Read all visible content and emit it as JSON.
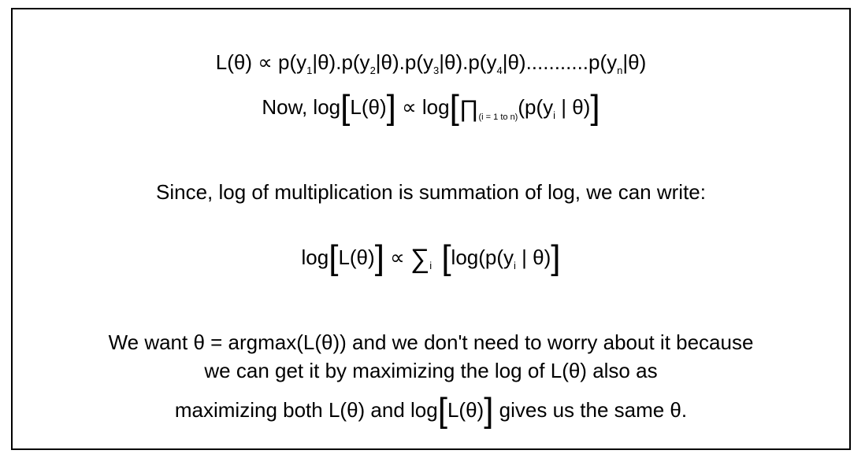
{
  "line1": {
    "prefix": "L(θ) ∝ p(y",
    "s1": "1",
    "t1": "|θ).p(y",
    "s2": "2",
    "t2": "|θ).p(y",
    "s3": "3",
    "t3": "|θ).p(y",
    "s4": "4",
    "t4": "|θ)...........p(y",
    "sn": "n",
    "t5": "|θ)"
  },
  "line2": {
    "now": "Now, log",
    "lb1": "[",
    "L": "L(θ)",
    "rb1": "]",
    "prop": " ∝ log",
    "lb2": "[",
    "prod": "∏",
    "range": "(i = 1 to n)",
    "inner": "(p(y",
    "idx": "i",
    "given": " | θ)",
    "rb2": "]"
  },
  "line3": "Since, log of multiplication is summation of log, we can write:",
  "line4": {
    "log": "log",
    "lb1": "[",
    "L": "L(θ)",
    "rb1": "]",
    "prop": " ∝ ",
    "sum": "∑",
    "sumidx": "i",
    "lb2": " [",
    "inner": "log(p(y",
    "idx": "i",
    "given": " | θ)",
    "rb2": "]"
  },
  "line5": "We want θ = argmax(L(θ)) and we don't need to worry about it because",
  "line6": "we can get it by maximizing the log of L(θ) also as",
  "line7": {
    "pre": "maximizing both L(θ) and log",
    "lb": "[",
    "L": "L(θ)",
    "rb": "]",
    "post": " gives us the same θ."
  }
}
